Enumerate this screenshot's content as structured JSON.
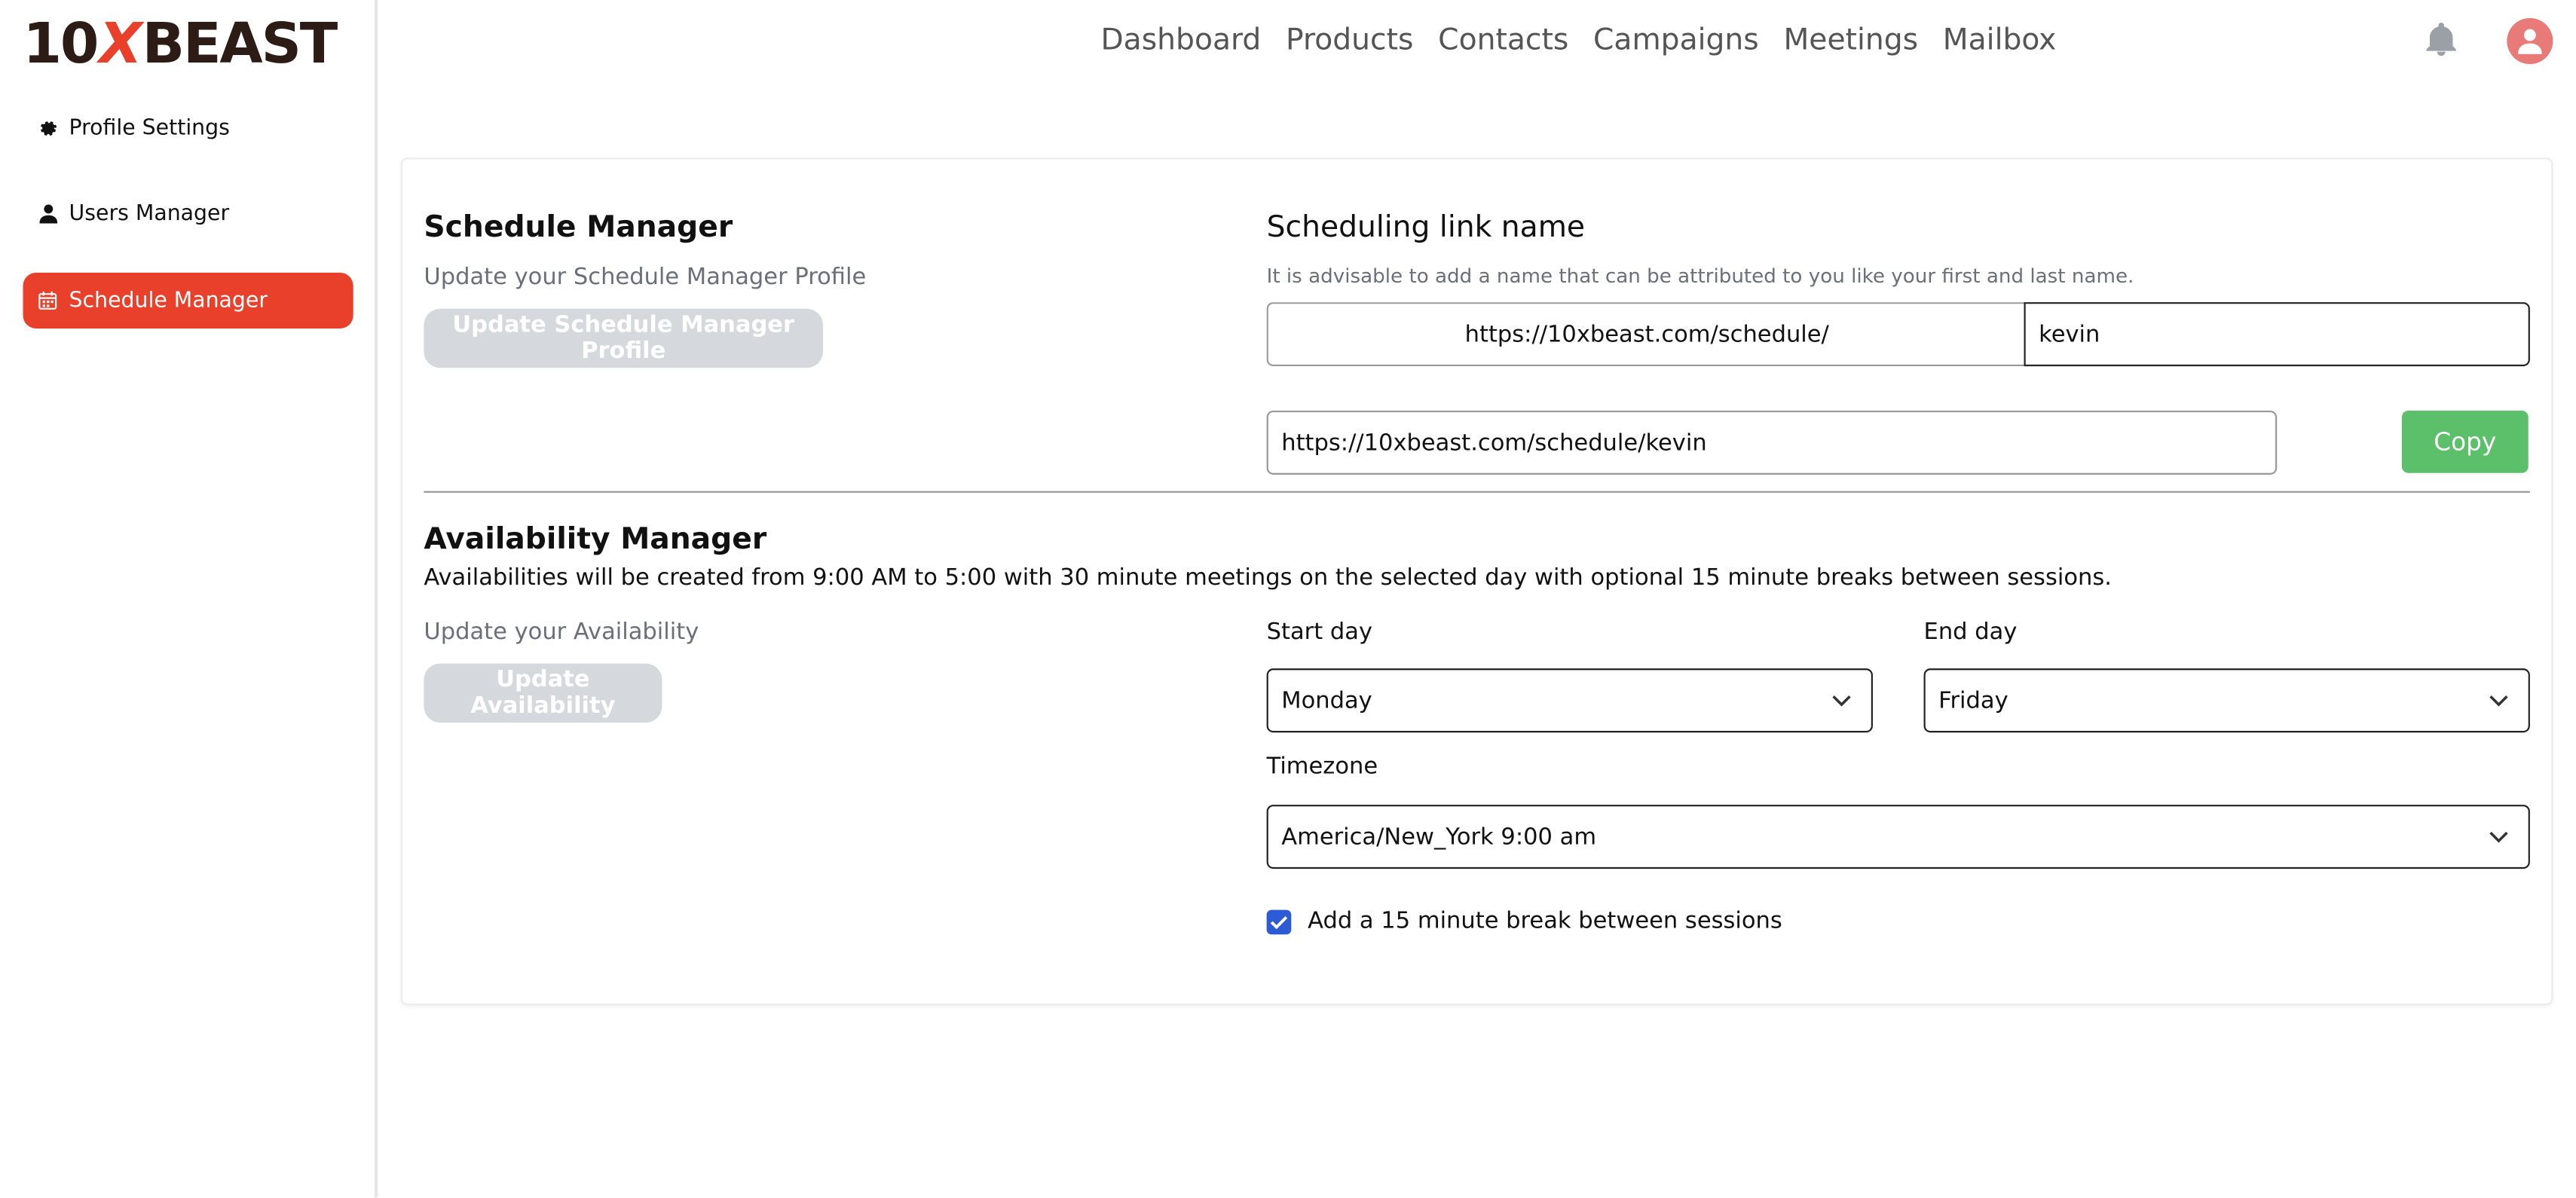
{
  "brand": {
    "logo_left": "10",
    "logo_x": "X",
    "logo_right": "BEAST"
  },
  "sidebar": {
    "items": [
      {
        "label": "Profile Settings",
        "icon": "gear-icon"
      },
      {
        "label": "Users Manager",
        "icon": "user-icon"
      },
      {
        "label": "Schedule Manager",
        "icon": "calendar-icon",
        "active": true
      }
    ]
  },
  "nav": {
    "items": [
      "Dashboard",
      "Products",
      "Contacts",
      "Campaigns",
      "Meetings",
      "Mailbox"
    ]
  },
  "schedule": {
    "title": "Schedule Manager",
    "subtitle": "Update your Schedule Manager Profile",
    "update_button": "Update Schedule Manager Profile"
  },
  "link": {
    "title": "Scheduling link name",
    "hint": "It is advisable to add a name that can be attributed to you like your first and last name.",
    "prefix": "https://10xbeast.com/schedule/",
    "name_value": "kevin",
    "full_link": "https://10xbeast.com/schedule/kevin",
    "copy_button": "Copy"
  },
  "availability": {
    "title": "Availability Manager",
    "description": "Availabilities will be created from 9:00 AM to 5:00 with 30 minute meetings on the selected day with optional 15 minute breaks between sessions.",
    "subtitle": "Update your Availability",
    "update_button": "Update Availability",
    "start_label": "Start day",
    "start_value": "Monday",
    "end_label": "End day",
    "end_value": "Friday",
    "timezone_label": "Timezone",
    "timezone_value": "America/New_York 9:00 am",
    "break_label": "Add a 15 minute break between sessions",
    "break_checked": true
  },
  "colors": {
    "accent": "#e8402a",
    "copy_green": "#5cbf6a",
    "checkbox_blue": "#2d5bd6",
    "avatar": "#e87b78"
  }
}
